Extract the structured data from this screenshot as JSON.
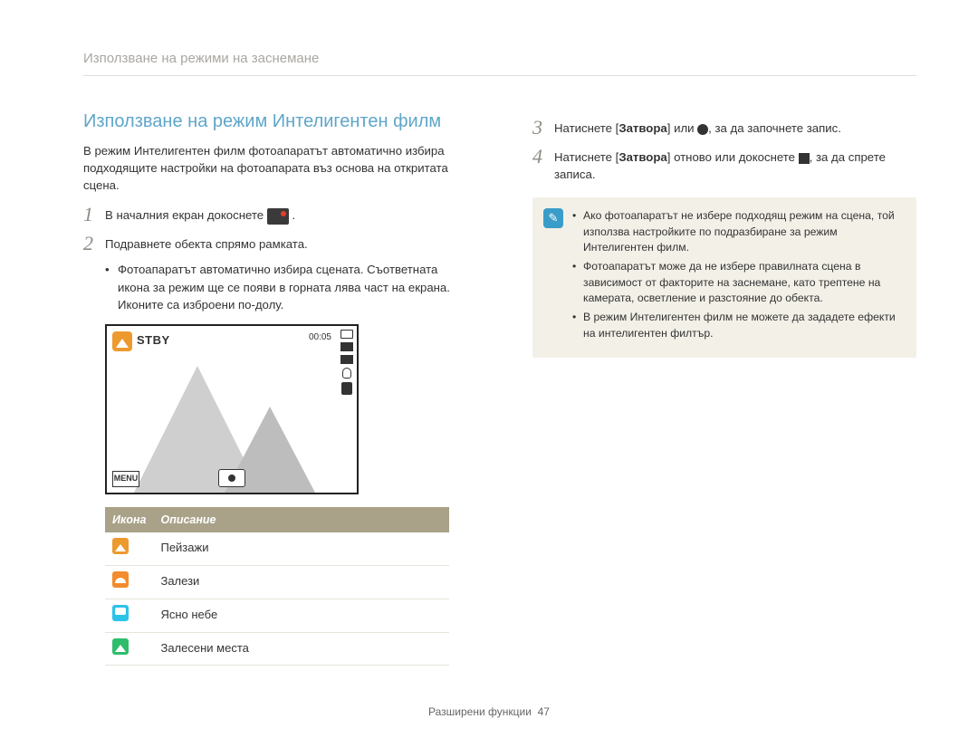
{
  "header": "Използване на режими на заснемане",
  "title": "Използване на режим Интелигентен филм",
  "intro": "В режим Интелигентен филм фотоапаратът автоматично избира подходящите настройки на фотоапарата въз основа на откритата сцена.",
  "step1": "В началния екран докоснете",
  "step1_suffix": ".",
  "step2": "Подравнете обекта спрямо рамката.",
  "step2_bullet": "Фотоапаратът автоматично избира сцената. Съответната икона за режим ще се появи в горната лява част на екрана. Иконите са изброени по-долу.",
  "screen": {
    "stby": "STBY",
    "timer": "00:05",
    "menu": "MENU"
  },
  "table": {
    "h1": "Икона",
    "h2": "Описание",
    "rows": [
      {
        "label": "Пейзажи"
      },
      {
        "label": "Залези"
      },
      {
        "label": "Ясно небе"
      },
      {
        "label": "Залесени места"
      }
    ]
  },
  "step3_a": "Натиснете [",
  "step3_b": "Затвора",
  "step3_c": "] или ",
  "step3_d": ", за да започнете запис.",
  "step4_a": "Натиснете [",
  "step4_b": "Затвора",
  "step4_c": "] отново или докоснете ",
  "step4_d": ", за да спрете записа.",
  "notes": [
    "Ако фотоапаратът не избере подходящ режим на сцена, той използва настройките по подразбиране за режим Интелигентен филм.",
    "Фотоапаратът може да не избере правилната сцена в зависимост от факторите на заснемане, като трептене на камерата, осветление и разстояние до обекта.",
    "В режим Интелигентен филм не можете да зададете ефекти на интелигентен филтър."
  ],
  "footer_a": "Разширени функции",
  "footer_b": "47"
}
